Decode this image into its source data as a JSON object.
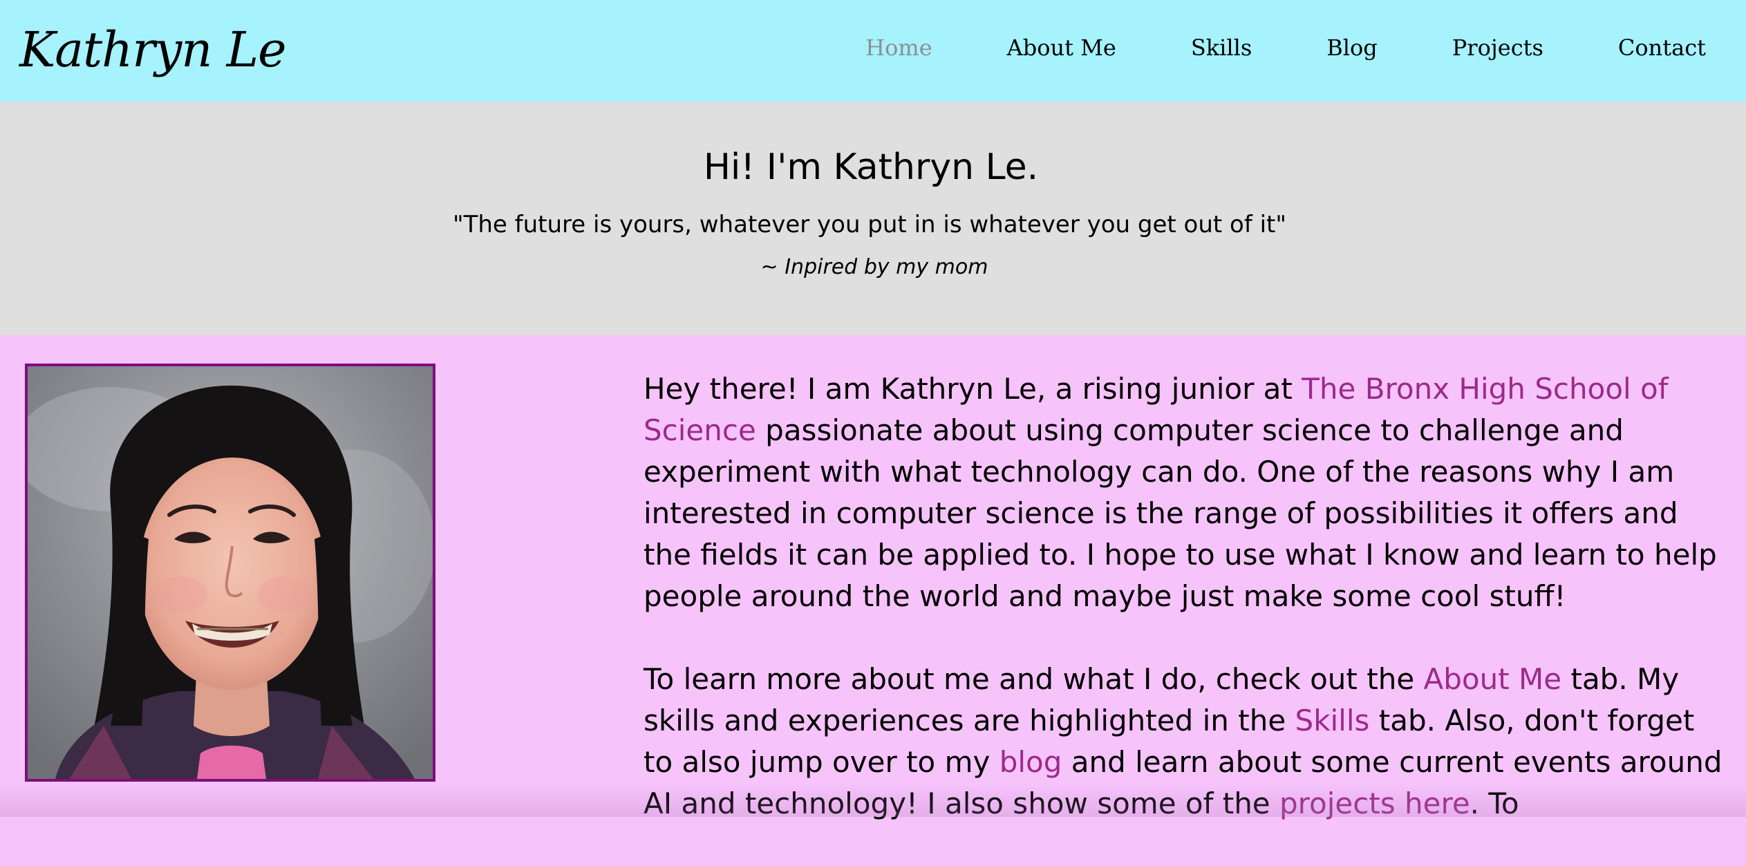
{
  "header": {
    "brand": "Kathryn Le",
    "nav": [
      {
        "label": "Home",
        "active": true
      },
      {
        "label": "About Me",
        "active": false
      },
      {
        "label": "Skills",
        "active": false
      },
      {
        "label": "Blog",
        "active": false
      },
      {
        "label": "Projects",
        "active": false
      },
      {
        "label": "Contact",
        "active": false
      }
    ]
  },
  "hero": {
    "title": "Hi! I'm Kathryn Le.",
    "quote": "\"The future is yours, whatever you put in is whatever you get out of it\"",
    "attribution": "~ Inpired by my mom"
  },
  "content": {
    "photo_alt": "Portrait of Kathryn Le",
    "paragraph1": {
      "t1": "Hey there! I am Kathryn Le, a rising junior at ",
      "link_school": "The Bronx High School of Science",
      "t2": " passionate about using computer science to challenge and experiment with what technology can do. One of the reasons why I am interested in computer science is the range of possibilities it offers and the fields it can be applied to. I hope to use what I know and learn to help people around the world and maybe just make some cool stuff!"
    },
    "paragraph2": {
      "t1": "To learn more about me and what I do, check out the ",
      "link_about": "About Me",
      "t2": " tab. My skills and experiences are highlighted in the ",
      "link_skills": "Skills",
      "t3": " tab. Also, don't forget to also jump over to my ",
      "link_blog": "blog",
      "t4": " and learn about some current events around AI and technology! I also show some of the ",
      "link_projects": "projects here",
      "t5": ". To"
    }
  },
  "colors": {
    "nav_bg": "#a6f2fd",
    "hero_bg": "#dfdfdf",
    "content_bg": "#f7c3fb",
    "link": "#9b2a8a",
    "active_nav": "#8f8f8f",
    "photo_border": "#7a0f7e"
  }
}
